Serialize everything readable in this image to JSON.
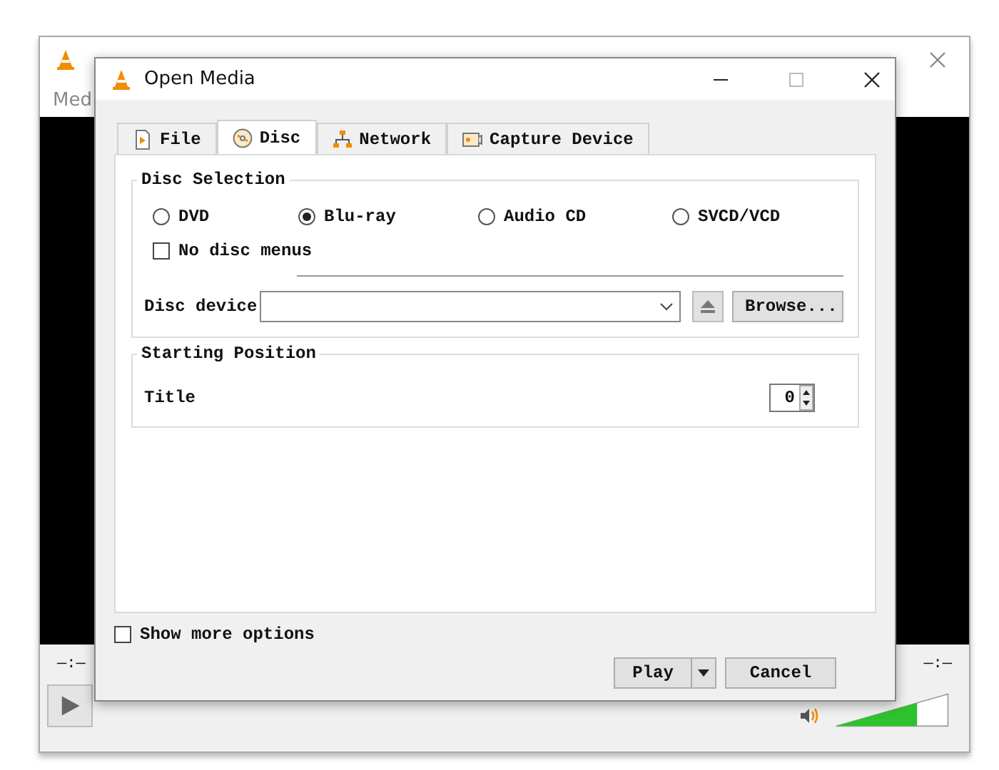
{
  "background_window": {
    "menu_text": "Med",
    "time_left": "—:—",
    "time_right": "—:—",
    "volume": {
      "level": 0.72
    }
  },
  "window": {
    "title": "Open Media"
  },
  "tabs": [
    {
      "label": "File",
      "kind": "file",
      "selected": false
    },
    {
      "label": "Disc",
      "kind": "disc",
      "selected": true
    },
    {
      "label": "Network",
      "kind": "network",
      "selected": false
    },
    {
      "label": "Capture Device",
      "kind": "capture",
      "selected": false
    }
  ],
  "disc_selection": {
    "title": "Disc Selection",
    "options": [
      {
        "label": "DVD",
        "selected": false
      },
      {
        "label": "Blu-ray",
        "selected": true
      },
      {
        "label": "Audio CD",
        "selected": false
      },
      {
        "label": "SVCD/VCD",
        "selected": false
      }
    ],
    "no_disc_menus": {
      "label": "No disc menus",
      "checked": false
    },
    "disc_device": {
      "label": "Disc device",
      "browse": "Browse..."
    }
  },
  "starting_position": {
    "title": "Starting Position",
    "title_label": "Title",
    "title_value": "0"
  },
  "show_more_options": {
    "label": "Show more options",
    "checked": false
  },
  "buttons": {
    "play": "Play",
    "cancel": "Cancel"
  }
}
